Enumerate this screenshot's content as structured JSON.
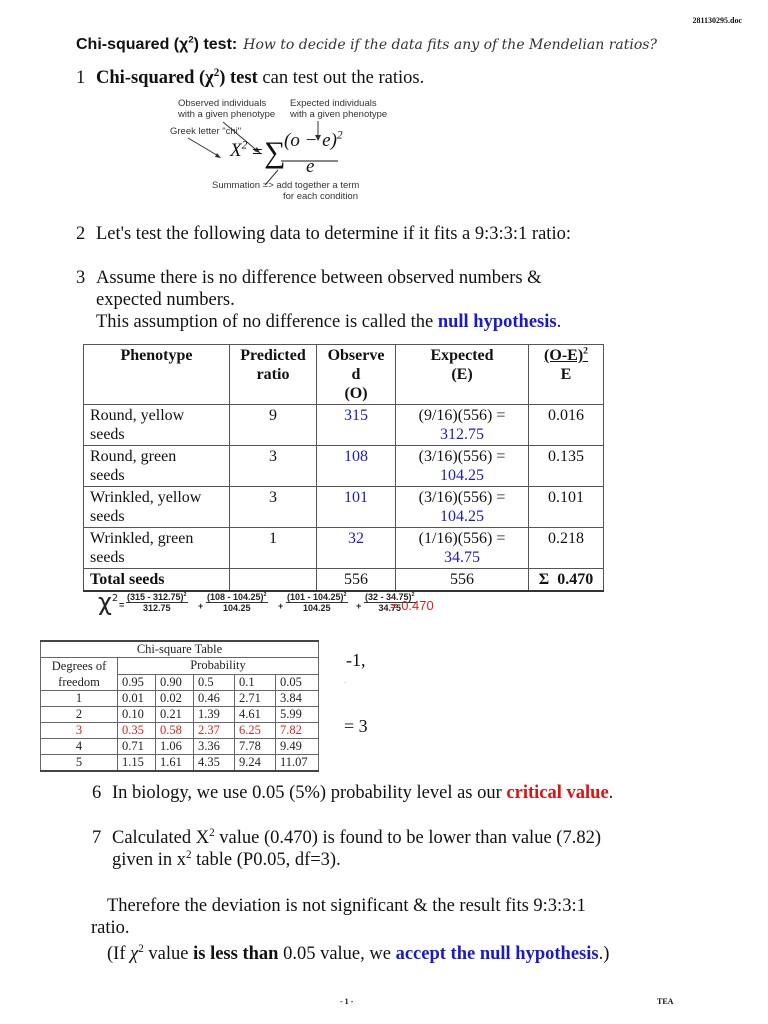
{
  "header": {
    "doc_name": "281130295.doc",
    "title_bold": "Chi-squared (χ",
    "title_sup": "2",
    "title_bold_end": ") test:",
    "title_italic": "How to decide if the data fits any of the Mendelian ratios?"
  },
  "section1": {
    "number": "1",
    "bold_a": "Chi-squared (χ",
    "sup": "2",
    "bold_b": ") test",
    "rest": " can test out the ratios."
  },
  "formula_figure": {
    "label_observed_1": "Observed individuals",
    "label_observed_2": "with a given phenotype",
    "label_expected_1": "Expected individuals",
    "label_expected_2": "with a given phenotype",
    "label_greek": "Greek letter \"chi\"",
    "lhs": "X",
    "lhs_sup": "2",
    "equals": "=",
    "sigma": "∑",
    "numerator": "(o − e)",
    "numerator_sup": "2",
    "denominator": "e",
    "label_summation_1": "Summation => add together a term",
    "label_summation_2": "for each condition"
  },
  "section2": {
    "number": "2",
    "text": "Let's test the following data to determine if it fits a 9:3:3:1 ratio:"
  },
  "section3": {
    "number": "3",
    "line1": "Assume there is no difference between observed numbers &",
    "line2": "expected numbers.",
    "line3_pre": "This assumption of no difference is called the ",
    "line3_highlight": "null hypothesis",
    "line3_post": "."
  },
  "main_table": {
    "headers": {
      "phenotype": "Phenotype",
      "predicted_1": "Predicted",
      "predicted_2": "ratio",
      "observed_1": "Observe",
      "observed_2": "d",
      "observed_3": "(O)",
      "expected_1": "Expected",
      "expected_2": "(E)",
      "chi_num": "(O-E)",
      "chi_sup": "2",
      "chi_den": "E"
    },
    "rows": [
      {
        "phenotype_1": "Round, yellow",
        "phenotype_2": "seeds",
        "ratio": "9",
        "observed": "315",
        "expected_formula": "(9/16)(556) =",
        "expected_value": "312.75",
        "chi": "0.016"
      },
      {
        "phenotype_1": "Round, green",
        "phenotype_2": "seeds",
        "ratio": "3",
        "observed": "108",
        "expected_formula": "(3/16)(556) =",
        "expected_value": "104.25",
        "chi": "0.135"
      },
      {
        "phenotype_1": "Wrinkled, yellow",
        "phenotype_2": "seeds",
        "ratio": "3",
        "observed": "101",
        "expected_formula": "(3/16)(556) =",
        "expected_value": "104.25",
        "chi": "0.101"
      },
      {
        "phenotype_1": "Wrinkled, green",
        "phenotype_2": "seeds",
        "ratio": "1",
        "observed": "32",
        "expected_formula": "(1/16)(556) =",
        "expected_value": "34.75",
        "chi": "0.218"
      }
    ],
    "total": {
      "label": "Total seeds",
      "ratio": "",
      "observed": "556",
      "expected": "556",
      "chi_symbol": "Σ",
      "chi": "0.470"
    }
  },
  "chi_calculation": {
    "symbol": "χ",
    "sup": "2",
    "equals": "=",
    "terms": [
      {
        "num": "(315 - 312.75)",
        "den": "312.75"
      },
      {
        "num": "(108 - 104.25)",
        "den": "104.25"
      },
      {
        "num": "(101 - 104.25)",
        "den": "104.25"
      },
      {
        "num": "(32 - 34.75)",
        "den": "34.75"
      }
    ],
    "term_sup": "2",
    "plus": "+",
    "result": "= 0.470"
  },
  "chi_square_table": {
    "title": "Chi-square Table",
    "df_label_1": "Degrees of",
    "df_label_2": "freedom",
    "probability_label": "Probability",
    "probabilities": [
      "0.95",
      "0.90",
      "0.5",
      "0.1",
      "0.05"
    ],
    "rows": [
      {
        "df": "1",
        "values": [
          "0.01",
          "0.02",
          "0.46",
          "2.71",
          "3.84"
        ]
      },
      {
        "df": "2",
        "values": [
          "0.10",
          "0.21",
          "1.39",
          "4.61",
          "5.99"
        ]
      },
      {
        "df": "3",
        "values": [
          "0.35",
          "0.58",
          "2.37",
          "6.25",
          "7.82"
        ]
      },
      {
        "df": "4",
        "values": [
          "0.71",
          "1.06",
          "3.36",
          "7.78",
          "9.49"
        ]
      },
      {
        "df": "5",
        "values": [
          "1.15",
          "1.61",
          "4.35",
          "9.24",
          "11.07"
        ]
      }
    ],
    "highlighted_df": "3",
    "highlight_color": "#dd2222"
  },
  "side_text": {
    "fragment_1": "-1,",
    "fragment_2": ".",
    "fragment_3": "= 3"
  },
  "section6": {
    "number": "6",
    "pre": "In biology, we use 0.05 (5%)  probability level as our ",
    "highlight": "critical value",
    "post": "."
  },
  "section7": {
    "number": "7",
    "line1_a": "Calculated X",
    "line1_sup": "2",
    "line1_b": " value (0.470) is found to be lower than value (7.82)",
    "line2_a": "given in x",
    "line2_sup": "2",
    "line2_b": " table (P0.05, df=3)."
  },
  "conclusion": {
    "line1": "Therefore the deviation is not significant & the result fits 9:3:3:1",
    "line2": "ratio.",
    "line3_open": "(If  ",
    "line3_chi": "χ",
    "line3_sup": "2",
    "line3_a": " value ",
    "line3_bold": "is less than",
    "line3_b": " 0.05 value, we ",
    "line3_highlight": "accept the null hypothesis",
    "line3_close": ".)"
  },
  "footer": {
    "page": "- 1 -",
    "author": "TEA"
  },
  "colors": {
    "highlight_blue": "#1a1acc",
    "highlight_red": "#dd1111"
  }
}
